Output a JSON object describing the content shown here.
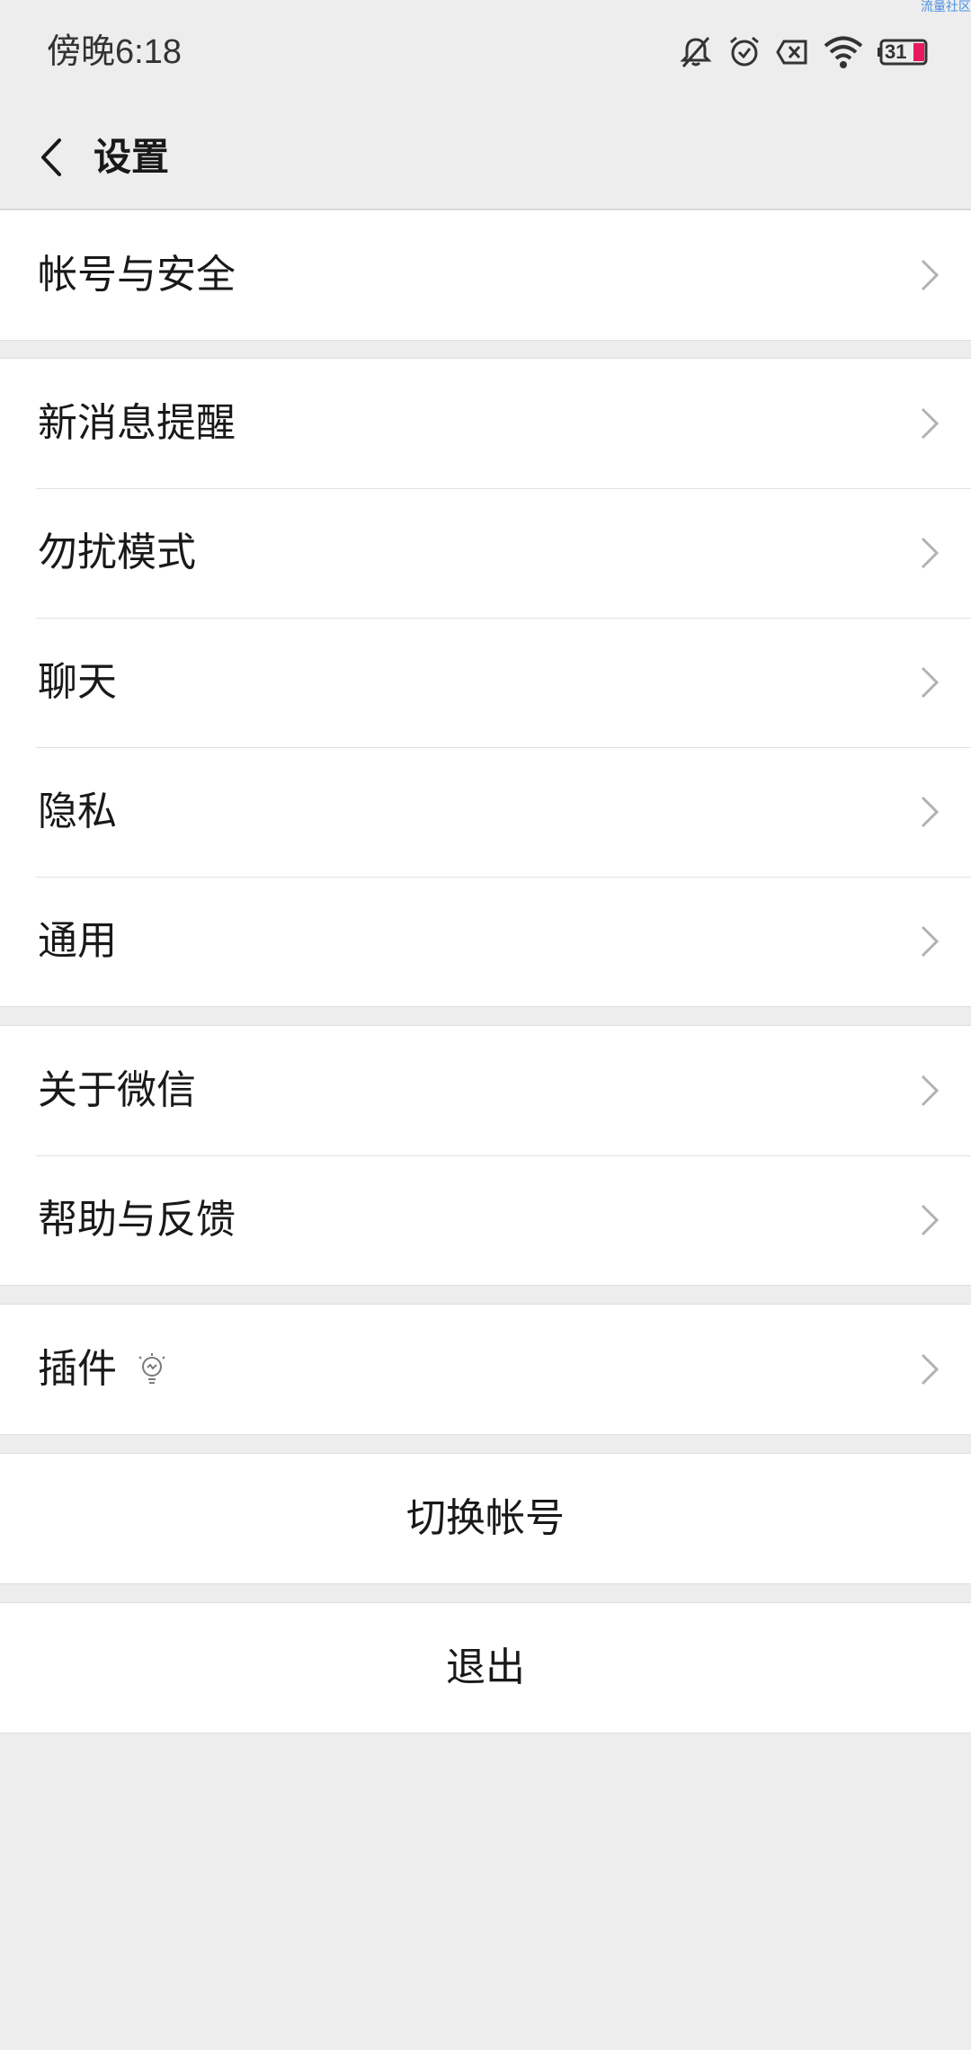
{
  "status_bar": {
    "time": "傍晚6:18",
    "battery": "31",
    "watermark": "流量社区",
    "icons": [
      "notifications-off-icon",
      "alarm-icon",
      "sim-error-icon",
      "wifi-icon",
      "battery-icon"
    ],
    "battery_level_color": "#e8185c"
  },
  "nav": {
    "title": "设置",
    "back_icon": "chevron-left-icon"
  },
  "groups": [
    {
      "items": [
        "帐号与安全"
      ]
    },
    {
      "items": [
        "新消息提醒",
        "勿扰模式",
        "聊天",
        "隐私",
        "通用"
      ]
    },
    {
      "items": [
        "关于微信",
        "帮助与反馈"
      ]
    },
    {
      "items": [
        "插件"
      ]
    }
  ],
  "actions": {
    "switch_account": "切换帐号",
    "logout": "退出"
  },
  "colors": {
    "background": "#ededed",
    "card": "#ffffff",
    "text": "#191919",
    "chevron": "#b2b2b2"
  }
}
